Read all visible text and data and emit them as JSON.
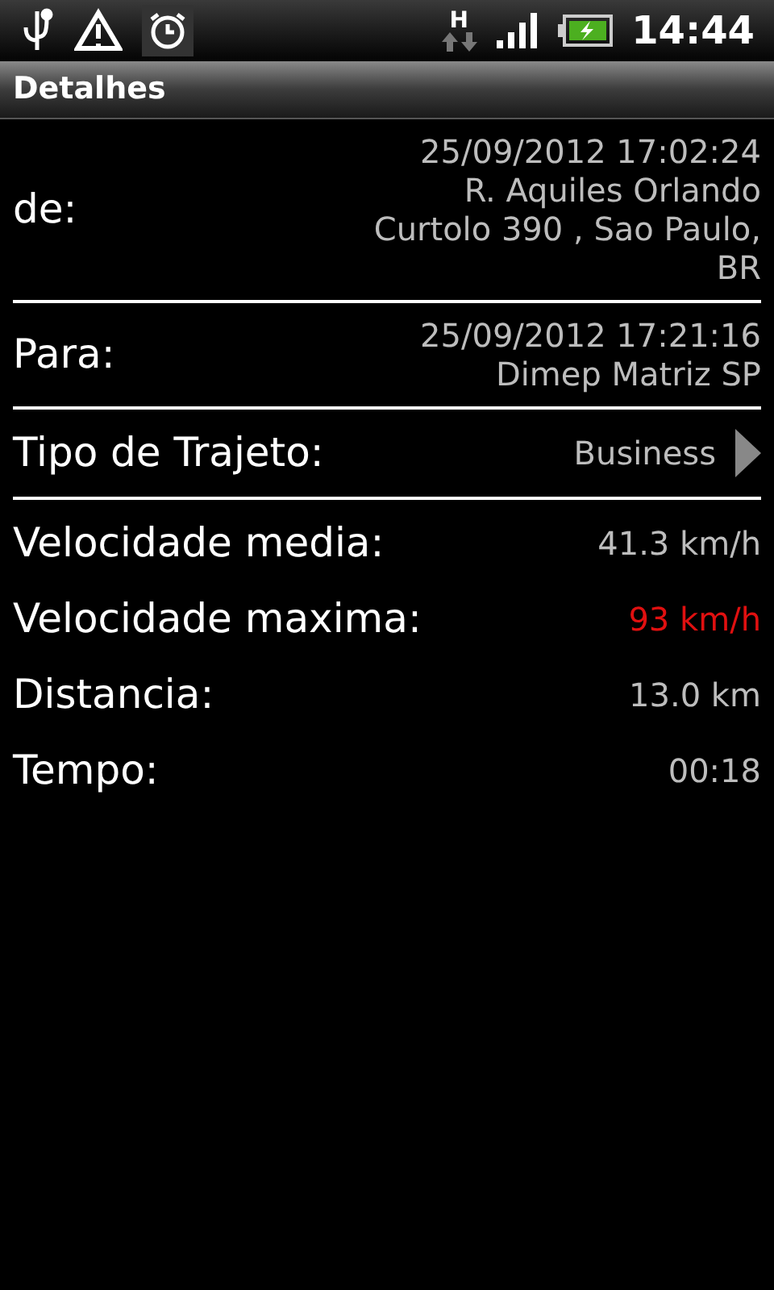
{
  "status_bar": {
    "network_type": "H",
    "time": "14:44"
  },
  "title": "Detalhes",
  "from": {
    "label": "de:",
    "datetime": "25/09/2012 17:02:24",
    "address_lines": [
      "R. Aquiles Orlando",
      "Curtolo 390 , Sao Paulo,",
      "BR"
    ]
  },
  "to": {
    "label": "Para:",
    "datetime": "25/09/2012 17:21:16",
    "address_lines": [
      "Dimep Matriz SP"
    ]
  },
  "trip_type": {
    "label": "Tipo de Trajeto:",
    "value": "Business"
  },
  "stats": [
    {
      "label": "Velocidade media:",
      "value": "41.3 km/h",
      "highlight": false
    },
    {
      "label": "Velocidade maxima:",
      "value": "93 km/h",
      "highlight": true
    },
    {
      "label": "Distancia:",
      "value": "13.0 km",
      "highlight": false
    },
    {
      "label": "Tempo:",
      "value": "00:18",
      "highlight": false
    }
  ]
}
